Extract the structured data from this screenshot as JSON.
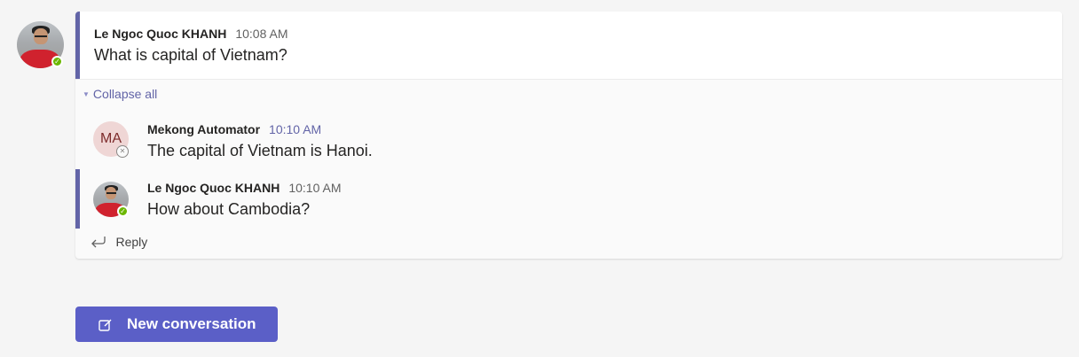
{
  "thread": {
    "root": {
      "author": "Le Ngoc Quoc KHANH",
      "time": "10:08 AM",
      "text": "What is capital of Vietnam?"
    },
    "collapse_label": "Collapse all",
    "replies": [
      {
        "author": "Mekong Automator",
        "initials": "MA",
        "time": "10:10 AM",
        "text": "The capital of Vietnam is Hanoi."
      },
      {
        "author": "Le Ngoc Quoc KHANH",
        "time": "10:10 AM",
        "text": "How about Cambodia?"
      }
    ],
    "reply_label": "Reply"
  },
  "actions": {
    "new_conversation_label": "New conversation"
  },
  "icons": {
    "status_available": "check-icon",
    "status_offline": "x-icon",
    "reply": "reply-arrow-icon",
    "compose": "compose-icon"
  },
  "colors": {
    "accent": "#6264a7",
    "button": "#5b5fc7",
    "available": "#6bb700",
    "ma_avatar_bg": "#efd6d5"
  }
}
